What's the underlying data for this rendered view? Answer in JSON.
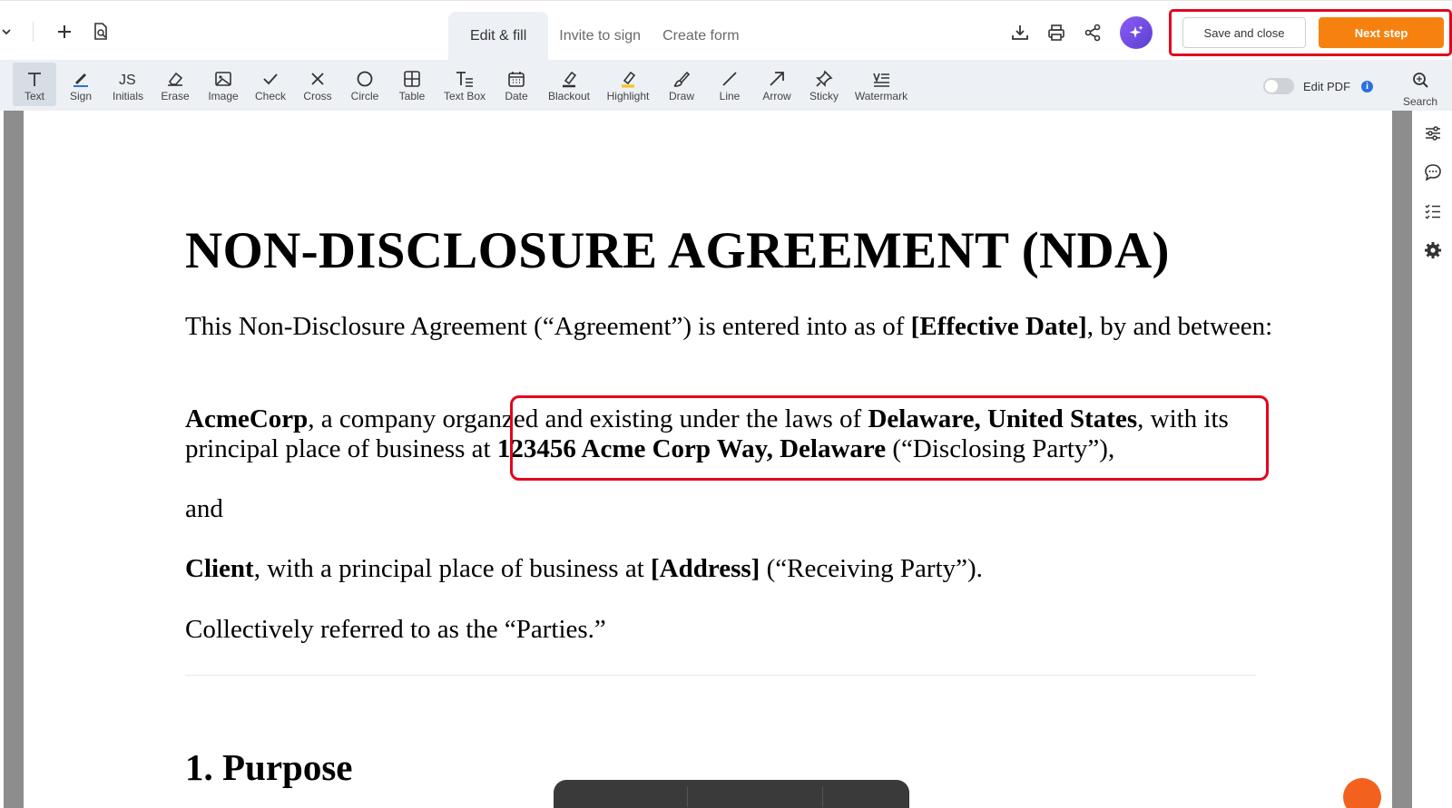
{
  "tabs": [
    {
      "label": "Edit & fill",
      "active": true
    },
    {
      "label": "Invite to sign",
      "active": false
    },
    {
      "label": "Create form",
      "active": false
    }
  ],
  "header": {
    "save_label": "Save and close",
    "next_label": "Next step",
    "accent_color": "#f7810f",
    "highlight_color": "#e1061d"
  },
  "tools": [
    {
      "label": "Text",
      "icon": "text-icon",
      "active": true
    },
    {
      "label": "Sign",
      "icon": "sign-pen-icon",
      "active": false
    },
    {
      "label": "Initials",
      "icon": "initials-icon",
      "active": false
    },
    {
      "label": "Erase",
      "icon": "eraser-icon",
      "active": false
    },
    {
      "label": "Image",
      "icon": "image-icon",
      "active": false
    },
    {
      "label": "Check",
      "icon": "check-icon",
      "active": false
    },
    {
      "label": "Cross",
      "icon": "cross-icon",
      "active": false
    },
    {
      "label": "Circle",
      "icon": "circle-icon",
      "active": false
    },
    {
      "label": "Table",
      "icon": "table-icon",
      "active": false
    },
    {
      "label": "Text Box",
      "icon": "text-box-icon",
      "active": false
    },
    {
      "label": "Date",
      "icon": "calendar-icon",
      "active": false
    },
    {
      "label": "Blackout",
      "icon": "blackout-icon",
      "active": false
    },
    {
      "label": "Highlight",
      "icon": "highlighter-icon",
      "active": false
    },
    {
      "label": "Draw",
      "icon": "brush-icon",
      "active": false
    },
    {
      "label": "Line",
      "icon": "line-icon",
      "active": false
    },
    {
      "label": "Arrow",
      "icon": "arrow-icon",
      "active": false
    },
    {
      "label": "Sticky",
      "icon": "pin-icon",
      "active": false
    },
    {
      "label": "Watermark",
      "icon": "watermark-icon",
      "active": false
    }
  ],
  "edit_pdf": {
    "label": "Edit PDF",
    "enabled": false
  },
  "search": {
    "label": "Search"
  },
  "document": {
    "title": "NON-DISCLOSURE AGREEMENT (NDA)",
    "p1": {
      "text_a": "This Non-Disclosure Agreement (“Agreement”) is entered into as of ",
      "bold_a": "[Effective Date]",
      "text_b": ", by and between:"
    },
    "p2": {
      "bold_a": "AcmeCorp",
      "text_a": ", a company organ",
      "text_b": "zed and existing under the laws of ",
      "bold_b": "Delaware, United States",
      "text_c": ", with its principal place of business at ",
      "bold_c": "123456 Acme Corp Way, Delaware",
      "text_d": " (“Disclosing Party”),"
    },
    "p3": "and",
    "p4": {
      "bold_a": "Client",
      "text_a": ", with a principal place of business at ",
      "bold_b": "[Address]",
      "text_b": " (“Receiving Party”)."
    },
    "p5": "Collectively referred to as the “Parties.”",
    "section_1": "1. Purpose"
  }
}
